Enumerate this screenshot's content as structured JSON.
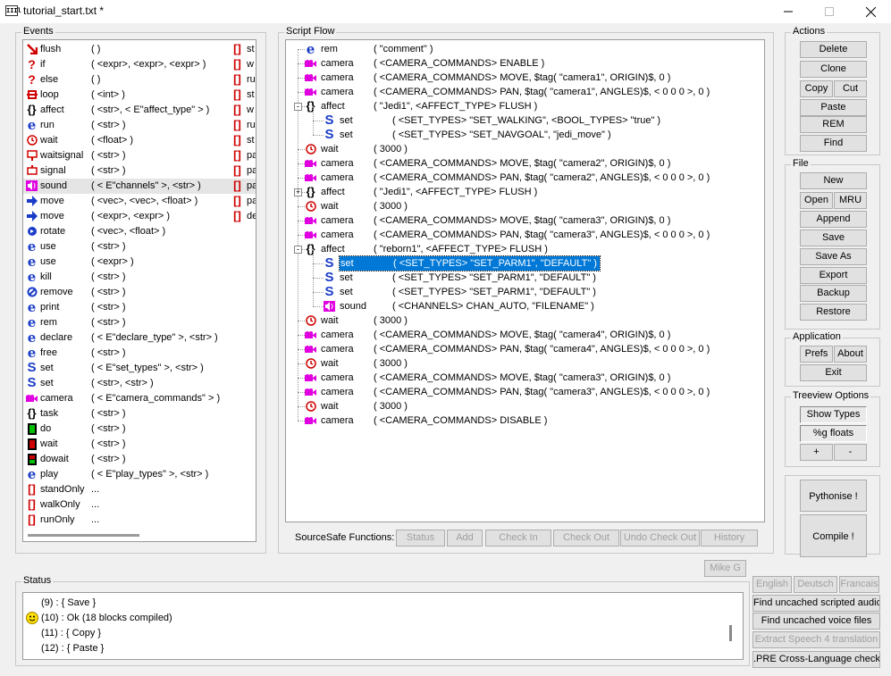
{
  "window": {
    "title": "tutorial_start.txt *",
    "icon_label": "IIIl"
  },
  "events": {
    "label": "Events",
    "rows": [
      {
        "icon": "flush-icon",
        "name": "flush",
        "args": "(  )"
      },
      {
        "icon": "if-icon",
        "name": "if",
        "args": "( <expr>, <expr>, <expr> )"
      },
      {
        "icon": "if-icon",
        "name": "else",
        "args": "(  )"
      },
      {
        "icon": "loop-icon",
        "name": "loop",
        "args": "( <int> )"
      },
      {
        "icon": "braces-icon",
        "name": "affect",
        "args": "( <str>, < E\"affect_type\" > )"
      },
      {
        "icon": "e-icon",
        "name": "run",
        "args": "( <str> )"
      },
      {
        "icon": "clock-icon",
        "name": "wait",
        "args": "( <float> )"
      },
      {
        "icon": "waitsignal-icon",
        "name": "waitsignal",
        "args": "( <str> )"
      },
      {
        "icon": "signal-icon",
        "name": "signal",
        "args": "( <str> )"
      },
      {
        "icon": "sound-icon",
        "name": "sound",
        "args": "( < E\"channels\" >, <str> )"
      },
      {
        "icon": "arrow-icon",
        "name": "move",
        "args": "( <vec>, <vec>, <float> )"
      },
      {
        "icon": "arrow-icon",
        "name": "move",
        "args": "( <expr>, <expr> )"
      },
      {
        "icon": "rotate-icon",
        "name": "rotate",
        "args": "( <vec>, <float> )"
      },
      {
        "icon": "e-icon",
        "name": "use",
        "args": "( <str> )"
      },
      {
        "icon": "e-icon",
        "name": "use",
        "args": "( <expr> )"
      },
      {
        "icon": "e-icon",
        "name": "kill",
        "args": "( <str> )"
      },
      {
        "icon": "remove-icon",
        "name": "remove",
        "args": "( <str> )"
      },
      {
        "icon": "e-icon",
        "name": "print",
        "args": "( <str> )"
      },
      {
        "icon": "e-icon",
        "name": "rem",
        "args": "( <str> )"
      },
      {
        "icon": "e-icon",
        "name": "declare",
        "args": "( < E\"declare_type\" >, <str> )"
      },
      {
        "icon": "e-icon",
        "name": "free",
        "args": "( <str> )"
      },
      {
        "icon": "set-icon",
        "name": "set",
        "args": "( < E\"set_types\" >, <str> )"
      },
      {
        "icon": "set-icon",
        "name": "set",
        "args": "( <str>, <str> )"
      },
      {
        "icon": "camera-icon",
        "name": "camera",
        "args": "( < E\"camera_commands\" > )"
      },
      {
        "icon": "braces-icon",
        "name": "task",
        "args": "( <str> )"
      },
      {
        "icon": "do-icon",
        "name": "do",
        "args": "( <str> )"
      },
      {
        "icon": "waittask-icon",
        "name": "wait",
        "args": "( <str> )"
      },
      {
        "icon": "dowait-icon",
        "name": "dowait",
        "args": "( <str> )"
      },
      {
        "icon": "e-icon",
        "name": "play",
        "args": "( < E\"play_types\" >, <str> )"
      },
      {
        "icon": "bracket-icon",
        "name": "standOnly",
        "args": "..."
      },
      {
        "icon": "bracket-icon",
        "name": "walkOnly",
        "args": "..."
      },
      {
        "icon": "bracket-icon",
        "name": "runOnly",
        "args": "..."
      }
    ],
    "side": [
      "st",
      "w",
      "ru",
      "st",
      "w",
      "ru",
      "st",
      "pa",
      "pa",
      "pa",
      "pa",
      "de"
    ]
  },
  "script": {
    "label": "Script Flow",
    "rows": [
      {
        "d": 0,
        "icon": "e-icon",
        "name": "rem",
        "args": "( \"comment\" )"
      },
      {
        "d": 0,
        "icon": "camera-icon",
        "name": "camera",
        "args": "( <CAMERA_COMMANDS> ENABLE )"
      },
      {
        "d": 0,
        "icon": "camera-icon",
        "name": "camera",
        "args": "( <CAMERA_COMMANDS> MOVE, $tag( \"camera1\", ORIGIN)$, 0 )"
      },
      {
        "d": 0,
        "icon": "camera-icon",
        "name": "camera",
        "args": "( <CAMERA_COMMANDS> PAN, $tag( \"camera1\", ANGLES)$, < 0 0 0 >, 0 )"
      },
      {
        "d": 0,
        "icon": "braces-icon",
        "name": "affect",
        "args": "( \"Jedi1\", <AFFECT_TYPE> FLUSH )",
        "exp": "-"
      },
      {
        "d": 1,
        "icon": "set-icon",
        "name": "set",
        "args": "( <SET_TYPES> \"SET_WALKING\", <BOOL_TYPES> \"true\" )"
      },
      {
        "d": 1,
        "icon": "set-icon",
        "name": "set",
        "args": "( <SET_TYPES> \"SET_NAVGOAL\", \"jedi_move\" )"
      },
      {
        "d": 0,
        "icon": "clock-icon",
        "name": "wait",
        "args": "( 3000 )"
      },
      {
        "d": 0,
        "icon": "camera-icon",
        "name": "camera",
        "args": "( <CAMERA_COMMANDS> MOVE, $tag( \"camera2\", ORIGIN)$, 0 )"
      },
      {
        "d": 0,
        "icon": "camera-icon",
        "name": "camera",
        "args": "( <CAMERA_COMMANDS> PAN, $tag( \"camera2\", ANGLES)$, < 0 0 0 >, 0 )"
      },
      {
        "d": 0,
        "icon": "braces-icon",
        "name": "affect",
        "args": "( \"Jedi1\", <AFFECT_TYPE> FLUSH )",
        "exp": "+"
      },
      {
        "d": 0,
        "icon": "clock-icon",
        "name": "wait",
        "args": "( 3000 )"
      },
      {
        "d": 0,
        "icon": "camera-icon",
        "name": "camera",
        "args": "( <CAMERA_COMMANDS> MOVE, $tag( \"camera3\", ORIGIN)$, 0 )"
      },
      {
        "d": 0,
        "icon": "camera-icon",
        "name": "camera",
        "args": "( <CAMERA_COMMANDS> PAN, $tag( \"camera3\", ANGLES)$, < 0 0 0 >, 0 )"
      },
      {
        "d": 0,
        "icon": "braces-icon",
        "name": "affect",
        "args": "( \"reborn1\", <AFFECT_TYPE> FLUSH )",
        "exp": "-"
      },
      {
        "d": 1,
        "icon": "set-icon",
        "name": "set",
        "args": "( <SET_TYPES> \"SET_PARM1\", \"DEFAULT\" )",
        "sel": true
      },
      {
        "d": 1,
        "icon": "set-icon",
        "name": "set",
        "args": "( <SET_TYPES> \"SET_PARM1\", \"DEFAULT\" )"
      },
      {
        "d": 1,
        "icon": "set-icon",
        "name": "set",
        "args": "( <SET_TYPES> \"SET_PARM1\", \"DEFAULT\" )"
      },
      {
        "d": 1,
        "icon": "sound-icon",
        "name": "sound",
        "args": "( <CHANNELS> CHAN_AUTO, \"FILENAME\" )"
      },
      {
        "d": 0,
        "icon": "clock-icon",
        "name": "wait",
        "args": "( 3000 )"
      },
      {
        "d": 0,
        "icon": "camera-icon",
        "name": "camera",
        "args": "( <CAMERA_COMMANDS> MOVE, $tag( \"camera4\", ORIGIN)$, 0 )"
      },
      {
        "d": 0,
        "icon": "camera-icon",
        "name": "camera",
        "args": "( <CAMERA_COMMANDS> PAN, $tag( \"camera4\", ANGLES)$, < 0 0 0 >, 0 )"
      },
      {
        "d": 0,
        "icon": "clock-icon",
        "name": "wait",
        "args": "( 3000 )"
      },
      {
        "d": 0,
        "icon": "camera-icon",
        "name": "camera",
        "args": "( <CAMERA_COMMANDS> MOVE, $tag( \"camera3\", ORIGIN)$, 0 )"
      },
      {
        "d": 0,
        "icon": "camera-icon",
        "name": "camera",
        "args": "( <CAMERA_COMMANDS> PAN, $tag( \"camera3\", ANGLES)$, < 0 0 0 >, 0 )"
      },
      {
        "d": 0,
        "icon": "clock-icon",
        "name": "wait",
        "args": "( 3000 )"
      },
      {
        "d": 0,
        "icon": "camera-icon",
        "name": "camera",
        "args": "( <CAMERA_COMMANDS> DISABLE )"
      }
    ],
    "sourcesafe_label": "SourceSafe Functions:",
    "sourcesafe": [
      "Status",
      "Add",
      "Check In",
      "Check Out",
      "Undo Check Out",
      "History"
    ]
  },
  "actions": {
    "label": "Actions",
    "delete": "Delete",
    "clone": "Clone",
    "copy": "Copy",
    "cut": "Cut",
    "paste": "Paste",
    "rem": "REM",
    "find": "Find"
  },
  "file": {
    "label": "File",
    "new": "New",
    "open": "Open",
    "mru": "MRU",
    "append": "Append",
    "save": "Save",
    "save_as": "Save As",
    "export": "Export",
    "backup": "Backup",
    "restore": "Restore"
  },
  "application": {
    "label": "Application",
    "prefs": "Prefs",
    "about": "About",
    "exit": "Exit"
  },
  "treeview": {
    "label": "Treeview Options",
    "show_types": "Show Types",
    "g_floats": "%g floats",
    "plus": "+",
    "minus": "-"
  },
  "big": {
    "pythonise": "Pythonise !",
    "compile": "Compile !"
  },
  "user": "Mike G",
  "status": {
    "label": "Status",
    "lines": [
      {
        "smile": false,
        "text": "(9) : { Save }"
      },
      {
        "smile": true,
        "text": "(10) : Ok   (18 blocks compiled)"
      },
      {
        "smile": false,
        "text": "(11) : { Copy }"
      },
      {
        "smile": false,
        "text": "(12) : { Paste }"
      }
    ]
  },
  "lang": {
    "english": "English",
    "deutsch": "Deutsch",
    "francais": "Francais"
  },
  "tools": {
    "uncached_audio": "Find uncached scripted audio",
    "uncached_voice": "Find uncached voice files",
    "extract": "Extract Speech 4 translation",
    "pre_check": ".PRE Cross-Language check"
  }
}
